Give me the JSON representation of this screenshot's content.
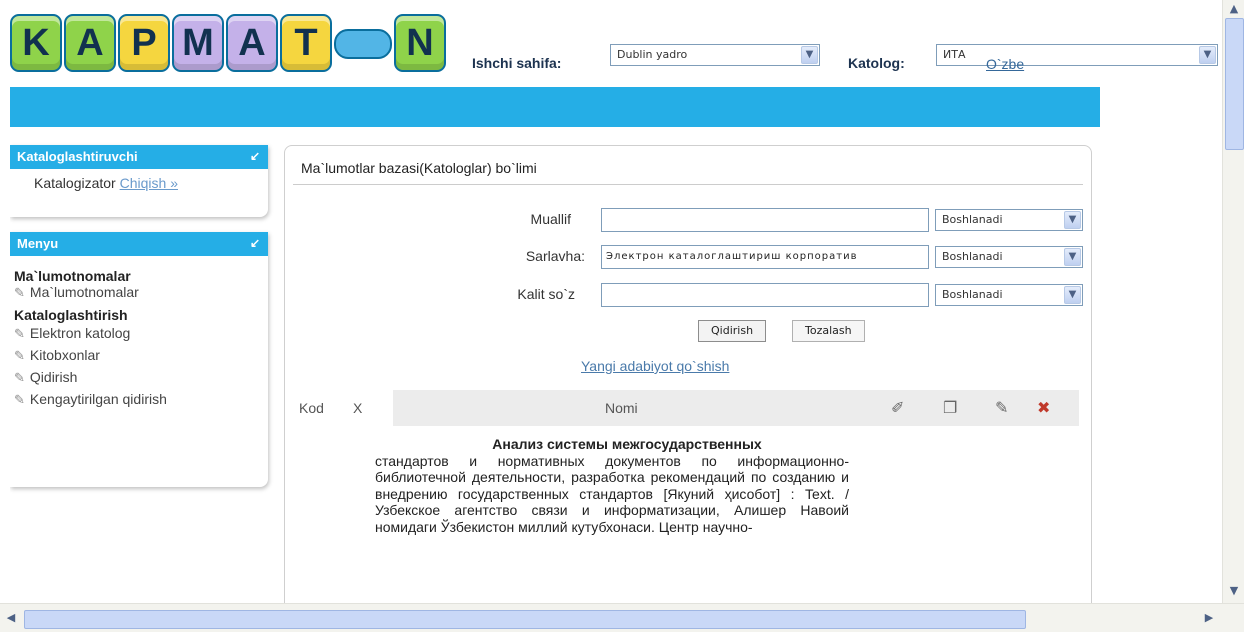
{
  "header": {
    "logo_letters": [
      "K",
      "A",
      "P",
      "M",
      "A",
      "T",
      "",
      "N"
    ],
    "workspace_label": "Ishchi sahifa:",
    "workspace_value": "Dublin yadro",
    "catalog_label": "Katolog:",
    "catalog_value": "ИТА",
    "language_link": "O`zbe"
  },
  "sidebar": {
    "cataloger_panel": {
      "title": "Kataloglashtiruvchi",
      "user": "Katalogizator",
      "logout": "Chiqish »"
    },
    "menu_panel": {
      "title": "Menyu",
      "sections": [
        {
          "heading": "Ma`lumotnomalar",
          "items": [
            "Ma`lumotnomalar"
          ]
        },
        {
          "heading": "Kataloglashtirish",
          "items": [
            "Elektron katolog",
            "Kitobxonlar",
            "Qidirish",
            "Kengaytirilgan qidirish"
          ]
        }
      ]
    }
  },
  "main": {
    "title": "Ma`lumotlar bazasi(Katologlar) bo`limi",
    "search": {
      "fields": [
        {
          "label": "Muallif",
          "value": "",
          "mode": "Boshlanadi"
        },
        {
          "label": "Sarlavha:",
          "value": "Электрон каталоглаштириш корпоратив",
          "mode": "Boshlanadi"
        },
        {
          "label": "Kalit so`z",
          "value": "",
          "mode": "Boshlanadi"
        }
      ],
      "search_button": "Qidirish",
      "clear_button": "Tozalash"
    },
    "add_link": "Yangi adabiyot qo`shish",
    "table": {
      "headers": {
        "code": "Kod",
        "x": "X",
        "name": "Nomi"
      },
      "row_description_bold": "Анализ системы межгосударственных",
      "row_description": "стандартов и нормативных документов по информационно-библиотечной деятельности, разработка рекомендаций по созданию и внедрению государственных стандартов [Якуний ҳисобот] : Text. / Узбекское агентство связи и информатизации, Алишер Навоий номидаги Ўзбекистон миллий кутубхонаси. Центр научно-"
    }
  },
  "colors": {
    "accent": "#25aee6",
    "link": "#4a7aaa"
  }
}
